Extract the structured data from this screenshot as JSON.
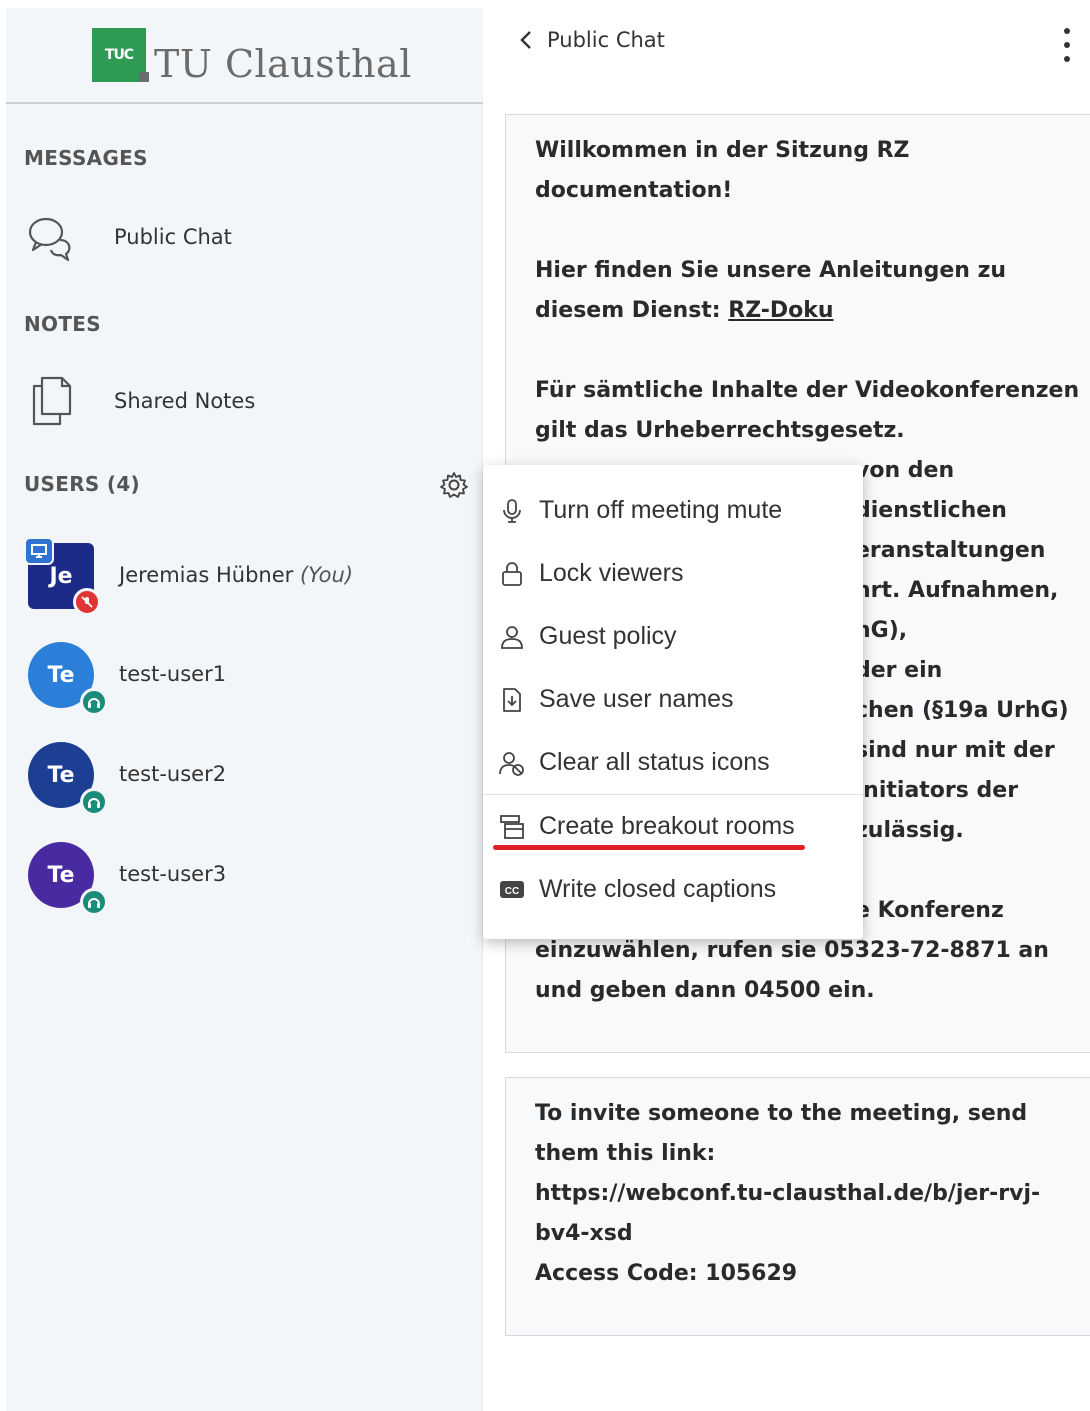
{
  "logo": {
    "text": "TU Clausthal",
    "mark": "TUC"
  },
  "sidebar": {
    "messages_title": "MESSAGES",
    "public_chat": "Public Chat",
    "notes_title": "NOTES",
    "shared_notes": "Shared Notes",
    "users_title": "USERS (4)",
    "users": [
      {
        "initials": "Je",
        "name": "Jeremias Hübner",
        "suffix": "(You)",
        "color": "#1b2b87"
      },
      {
        "initials": "Te",
        "name": "test-user1",
        "color": "#2b7fd8"
      },
      {
        "initials": "Te",
        "name": "test-user2",
        "color": "#1c3f94"
      },
      {
        "initials": "Te",
        "name": "test-user3",
        "color": "#4a2aa0"
      }
    ]
  },
  "chat": {
    "title": "Public Chat",
    "welcome_lines": [
      "Willkommen in der Sitzung RZ",
      "documentation!"
    ],
    "guide_line1": "Hier finden Sie unsere Anleitungen zu",
    "guide_line2_prefix": "diesem Dienst: ",
    "guide_link": "RZ-Doku",
    "copyright_lines": [
      "Für sämtliche Inhalte der Videokonferenzen",
      "gilt das Urheberrechtsgesetz."
    ],
    "hidden_fragments": [
      "von den",
      "dienstlichen",
      "eranstaltungen",
      "hrt. Aufnahmen,",
      "hG),",
      "der ein",
      "chen (§19a UrhG)",
      "sind nur mit der",
      "Initiators der",
      "zulässig."
    ],
    "dialin_fragment": "e Konferenz",
    "dialin_lines": [
      "einzuwählen, rufen sie 05323-72-8871 an",
      "und geben dann 04500 ein."
    ],
    "invite_lines": [
      "To invite someone to the meeting, send",
      "them this link:",
      "https://webconf.tu-clausthal.de/b/jer-rvj-",
      "bv4-xsd",
      "Access Code: 105629"
    ]
  },
  "menu": {
    "items": [
      {
        "label": "Turn off meeting mute",
        "icon": "mic-icon"
      },
      {
        "label": "Lock viewers",
        "icon": "lock-icon"
      },
      {
        "label": "Guest policy",
        "icon": "user-icon"
      },
      {
        "label": "Save user names",
        "icon": "download-file-icon"
      },
      {
        "label": "Clear all status icons",
        "icon": "clear-status-icon"
      },
      {
        "label": "Create breakout rooms",
        "icon": "breakout-rooms-icon"
      },
      {
        "label": "Write closed captions",
        "icon": "closed-captions-icon"
      }
    ],
    "highlight_color": "#e01e2a"
  }
}
